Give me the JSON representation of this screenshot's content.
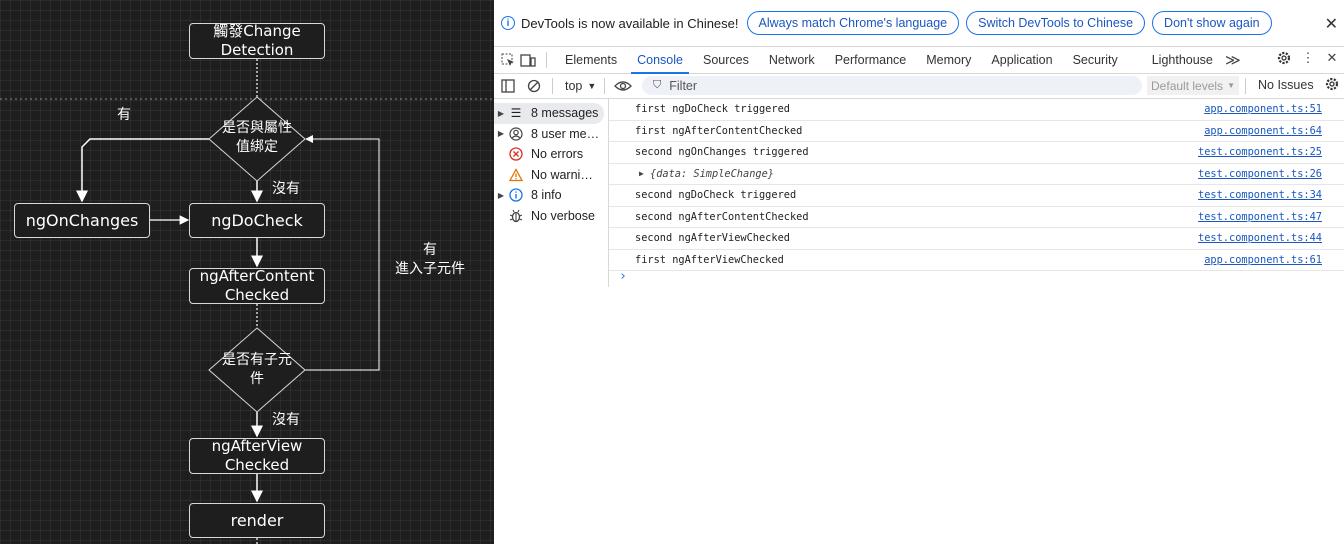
{
  "flowchart": {
    "nodes": {
      "trigger": "觸發Change\nDetection",
      "ngOnChanges": "ngOnChanges",
      "ngDoCheck": "ngDoCheck",
      "ngAfterContentChecked": "ngAfterContent\nChecked",
      "ngAfterViewChecked": "ngAfterView\nChecked",
      "render": "render"
    },
    "decisions": {
      "bound": "是否與屬性\n值綁定",
      "children": "是否有子元\n件"
    },
    "edge_labels": {
      "yes_left": "有",
      "no_bound": "沒有",
      "no_children": "沒有",
      "yes_children": "有\n進入子元件"
    },
    "colors": {
      "background": "#1e1e1e",
      "line": "#ffffff"
    }
  },
  "devtools": {
    "infobar": {
      "message": "DevTools is now available in Chinese!",
      "buttons": [
        "Always match Chrome's language",
        "Switch DevTools to Chinese",
        "Don't show again"
      ],
      "close": "✕"
    },
    "tabs": [
      "Elements",
      "Console",
      "Sources",
      "Network",
      "Performance",
      "Memory",
      "Application",
      "Security",
      "Lighthouse"
    ],
    "active_tab": "Console",
    "more_tabs": "≫",
    "toolbar": {
      "context": "top",
      "filter_placeholder": "Filter",
      "levels": "Default levels",
      "issues": "No Issues"
    },
    "sidebar": [
      {
        "label": "8 messages",
        "icon": "list-icon",
        "expandable": true,
        "selected": true
      },
      {
        "label": "8 user me…",
        "icon": "user-icon",
        "expandable": true,
        "selected": false
      },
      {
        "label": "No errors",
        "icon": "error-icon",
        "expandable": false,
        "selected": false
      },
      {
        "label": "No warni…",
        "icon": "warning-icon",
        "expandable": false,
        "selected": false
      },
      {
        "label": "8 info",
        "icon": "info-icon",
        "expandable": true,
        "selected": false
      },
      {
        "label": "No verbose",
        "icon": "bug-icon",
        "expandable": false,
        "selected": false
      }
    ],
    "logs": [
      {
        "message": "first ngDoCheck triggered",
        "source": "app.component.ts:51"
      },
      {
        "message": "first ngAfterContentChecked",
        "source": "app.component.ts:64"
      },
      {
        "message": "second ngOnChanges triggered",
        "source": "test.component.ts:25"
      },
      {
        "message": "{data: SimpleChange}",
        "source": "test.component.ts:26",
        "object": true
      },
      {
        "message": "second ngDoCheck triggered",
        "source": "test.component.ts:34"
      },
      {
        "message": "second ngAfterContentChecked",
        "source": "test.component.ts:47"
      },
      {
        "message": "second ngAfterViewChecked",
        "source": "test.component.ts:44"
      },
      {
        "message": "first ngAfterViewChecked",
        "source": "app.component.ts:61"
      }
    ],
    "prompt": "›",
    "colors": {
      "accent": "#1a73e8",
      "link": "#1a57c0",
      "error": "#d93025",
      "warning": "#e37400"
    }
  }
}
